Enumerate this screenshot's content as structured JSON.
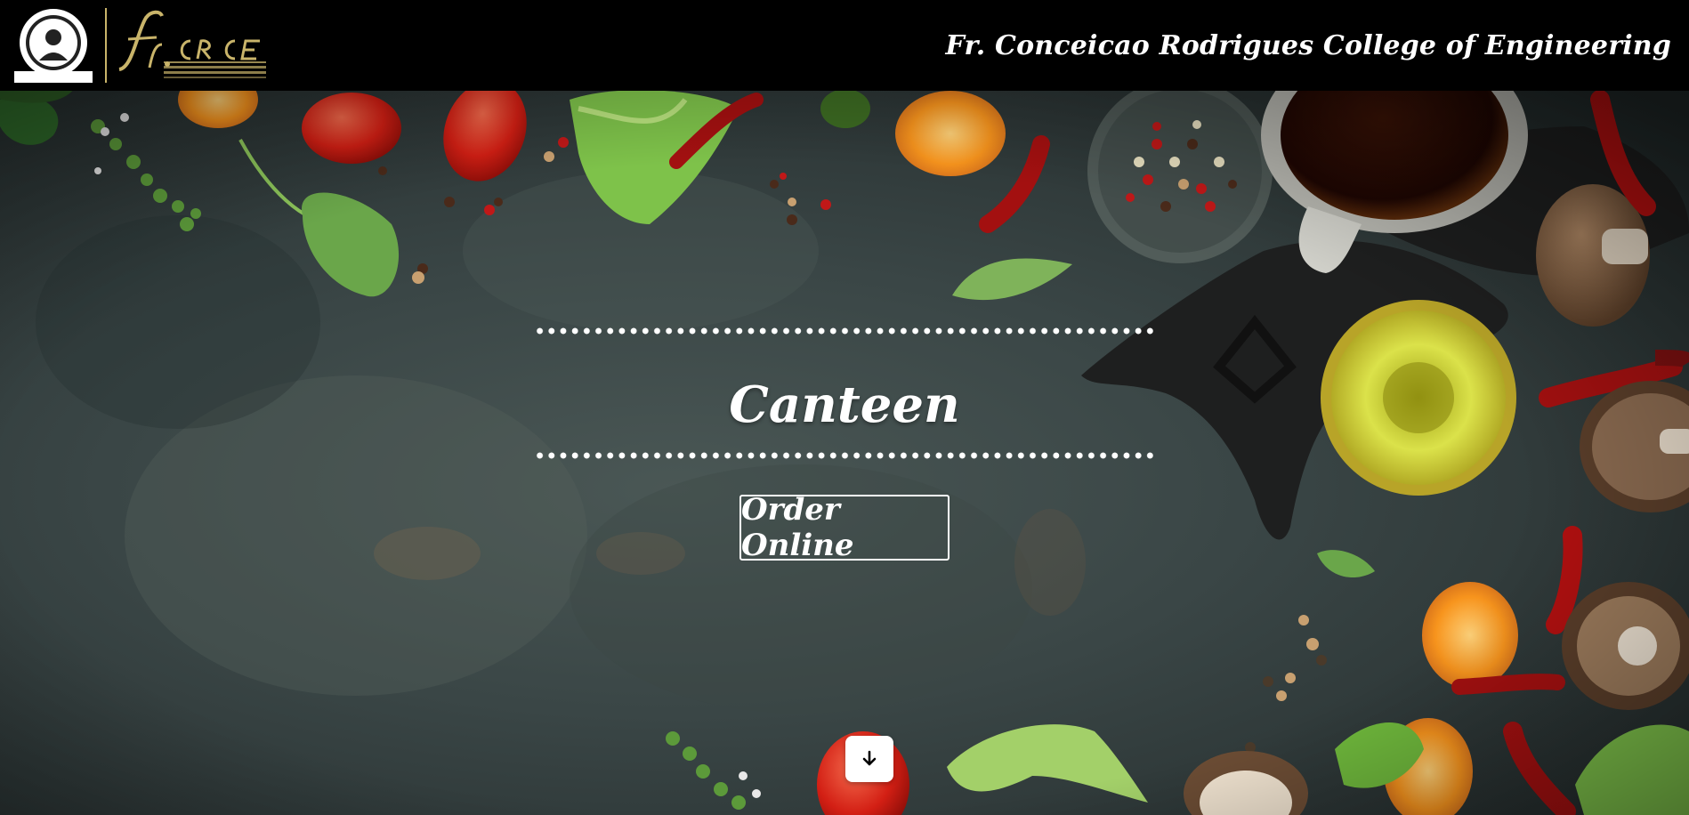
{
  "navbar": {
    "college_name": "Fr. Conceicao Rodrigues College of Engineering",
    "seal_label": "FR. AGNEL TECHNICAL COMPLEX",
    "logo_text": "fr.CRCE",
    "logo_subtext": "FR. CONCEICAO RODRIGUES COLLEGE OF ENGINEERING"
  },
  "hero": {
    "title": "Canteen",
    "order_button_label": "Order Online",
    "scroll_icon": "arrow-down-icon"
  },
  "colors": {
    "navbar_bg": "#000000",
    "logo_gold": "#c9b46a",
    "text": "#ffffff"
  }
}
